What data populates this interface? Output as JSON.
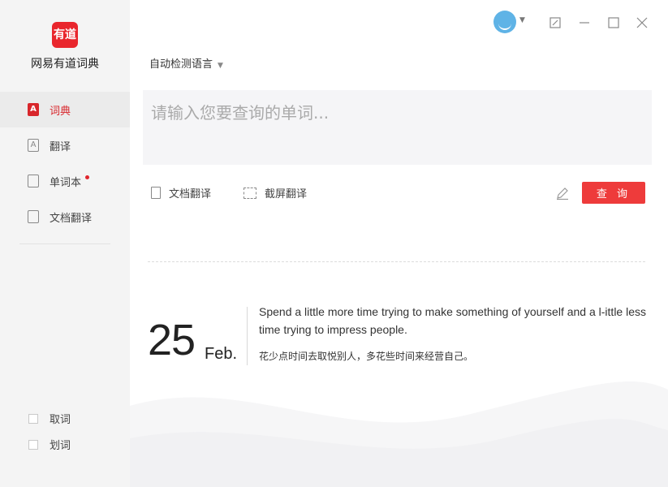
{
  "app": {
    "logo_text": "有道",
    "name": "网易有道词典"
  },
  "sidebar": {
    "items": [
      {
        "label": "词典",
        "icon": "dictionary-icon",
        "glyph": "A",
        "active": true
      },
      {
        "label": "翻译",
        "icon": "translate-icon",
        "glyph": "A",
        "active": false
      },
      {
        "label": "单词本",
        "icon": "wordbook-icon",
        "glyph": "",
        "active": false,
        "badge": true
      },
      {
        "label": "文档翻译",
        "icon": "document-translate-icon",
        "glyph": "",
        "active": false
      }
    ],
    "options": [
      {
        "label": "取词",
        "checked": false
      },
      {
        "label": "划词",
        "checked": false
      }
    ]
  },
  "main": {
    "language_select": "自动检测语言",
    "search_placeholder": "请输入您要查询的单词...",
    "tools": {
      "doc_translate": "文档翻译",
      "screenshot_translate": "截屏翻译"
    },
    "query_button": "查 询"
  },
  "daily": {
    "day": "25",
    "month": "Feb.",
    "quote_en": "Spend a little more time trying to make something of yourself and a l-ittle less time trying to impress people.",
    "quote_zh": "花少点时间去取悦别人，多花些时间来经营自己。"
  },
  "colors": {
    "accent": "#e9262d",
    "sidebar_bg": "#f4f4f4",
    "input_bg": "#f5f5f7"
  }
}
